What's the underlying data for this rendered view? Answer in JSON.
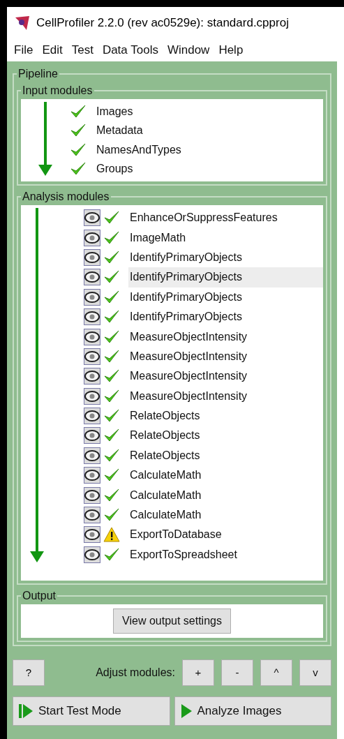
{
  "window": {
    "title": "CellProfiler 2.2.0 (rev ac0529e): standard.cpproj"
  },
  "menu": [
    "File",
    "Edit",
    "Test",
    "Data Tools",
    "Window",
    "Help"
  ],
  "pipeline": {
    "title": "Pipeline",
    "input_modules": {
      "title": "Input modules",
      "items": [
        {
          "name": "Images",
          "kind": "ok"
        },
        {
          "name": "Metadata",
          "kind": "ok"
        },
        {
          "name": "NamesAndTypes",
          "kind": "ok"
        },
        {
          "name": "Groups",
          "kind": "ok"
        }
      ]
    },
    "analysis_modules": {
      "title": "Analysis modules",
      "items": [
        {
          "name": "EnhanceOrSuppressFeatures",
          "kind": "ok",
          "selected": false
        },
        {
          "name": "ImageMath",
          "kind": "ok",
          "selected": false
        },
        {
          "name": "IdentifyPrimaryObjects",
          "kind": "ok",
          "selected": false
        },
        {
          "name": "IdentifyPrimaryObjects",
          "kind": "ok",
          "selected": true
        },
        {
          "name": "IdentifyPrimaryObjects",
          "kind": "ok",
          "selected": false
        },
        {
          "name": "IdentifyPrimaryObjects",
          "kind": "ok",
          "selected": false
        },
        {
          "name": "MeasureObjectIntensity",
          "kind": "ok",
          "selected": false
        },
        {
          "name": "MeasureObjectIntensity",
          "kind": "ok",
          "selected": false
        },
        {
          "name": "MeasureObjectIntensity",
          "kind": "ok",
          "selected": false
        },
        {
          "name": "MeasureObjectIntensity",
          "kind": "ok",
          "selected": false
        },
        {
          "name": "RelateObjects",
          "kind": "ok",
          "selected": false
        },
        {
          "name": "RelateObjects",
          "kind": "ok",
          "selected": false
        },
        {
          "name": "RelateObjects",
          "kind": "ok",
          "selected": false
        },
        {
          "name": "CalculateMath",
          "kind": "ok",
          "selected": false
        },
        {
          "name": "CalculateMath",
          "kind": "ok",
          "selected": false
        },
        {
          "name": "CalculateMath",
          "kind": "ok",
          "selected": false
        },
        {
          "name": "ExportToDatabase",
          "kind": "warning",
          "selected": false
        },
        {
          "name": "ExportToSpreadsheet",
          "kind": "ok",
          "selected": false
        }
      ]
    }
  },
  "output": {
    "title": "Output",
    "button": "View output settings"
  },
  "adjust": {
    "help_button": "?",
    "label": "Adjust modules:",
    "buttons": [
      "+",
      "-",
      "^",
      "v"
    ]
  },
  "actions": [
    "Start Test Mode",
    "Analyze Images"
  ]
}
